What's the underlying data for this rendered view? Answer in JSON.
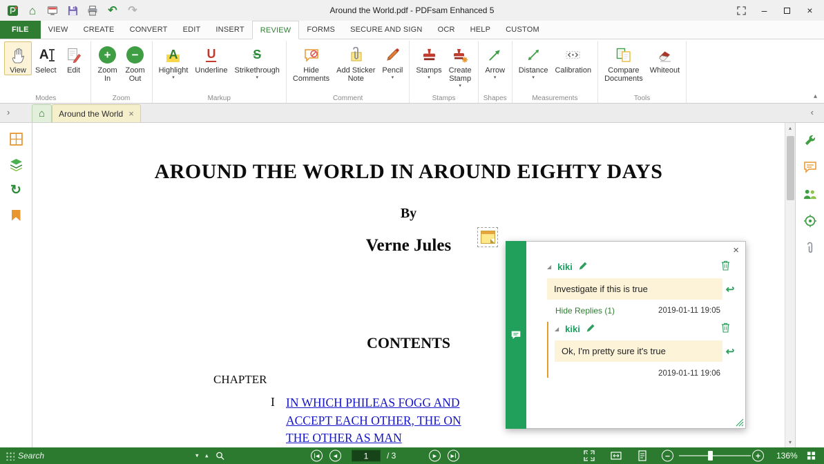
{
  "titlebar": {
    "title": "Around the World.pdf   -   PDFsam Enhanced 5"
  },
  "menubar": {
    "file": "FILE",
    "view": "VIEW",
    "create": "CREATE",
    "convert": "CONVERT",
    "edit": "EDIT",
    "insert": "INSERT",
    "review": "REVIEW",
    "forms": "FORMS",
    "secure_and_sign": "SECURE AND SIGN",
    "ocr": "OCR",
    "help": "HELP",
    "custom": "CUSTOM"
  },
  "ribbon": {
    "groups": {
      "modes": "Modes",
      "zoom": "Zoom",
      "markup": "Markup",
      "comment": "Comment",
      "stamps": "Stamps",
      "shapes": "Shapes",
      "measurements": "Measurements",
      "tools": "Tools"
    },
    "buttons": {
      "view": "View",
      "select": "Select",
      "edit": "Edit",
      "zoom_in": "Zoom\nIn",
      "zoom_out": "Zoom\nOut",
      "highlight": "Highlight",
      "underline": "Underline",
      "strikethrough": "Strikethrough",
      "hide_comments": "Hide\nComments",
      "add_sticker_note": "Add Sticker\nNote",
      "pencil": "Pencil",
      "stamps": "Stamps",
      "create_stamp": "Create\nStamp",
      "arrow": "Arrow",
      "distance": "Distance",
      "calibration": "Calibration",
      "compare_documents": "Compare\nDocuments",
      "whiteout": "Whiteout"
    }
  },
  "tabbar": {
    "document_tab": "Around the World"
  },
  "page": {
    "title": "AROUND THE WORLD IN AROUND EIGHTY DAYS",
    "byline": "By",
    "author": "Verne Jules",
    "contents_heading": "CONTENTS",
    "chapter_label": "CHAPTER",
    "chapter_number": "I",
    "toc_link_line1": "IN WHICH PHILEAS FOGG AND",
    "toc_link_line2": "ACCEPT EACH OTHER, THE ON",
    "toc_link_line3": "THE OTHER AS MAN"
  },
  "comment_popup": {
    "author": "kiki",
    "comment_text": "Investigate if this is true",
    "hide_replies": "Hide Replies  (1)",
    "timestamp": "2019-01-11 19:05",
    "reply_author": "kiki",
    "reply_text": "Ok, I'm pretty sure it's true",
    "reply_timestamp": "2019-01-11 19:06"
  },
  "statusbar": {
    "search_placeholder": "Search",
    "current_page": "1",
    "page_count": "/ 3",
    "zoom_percent": "136%"
  },
  "icons": {
    "home": "⌂",
    "undo": "↶",
    "redo": "↷",
    "close": "×",
    "minimize": "–",
    "chevron_up": "▴",
    "chevron_down": "▾",
    "chevron_left": "‹",
    "chevron_right": "›",
    "rotate_pages": "↻",
    "prev": "◀",
    "next": "▶",
    "plus": "+",
    "minus": "−",
    "reply": "↩",
    "collapse_triangle": "◢",
    "select_letter": "A",
    "highlight_letter": "A",
    "underline_letter": "U",
    "strikethrough_letter": "S"
  }
}
